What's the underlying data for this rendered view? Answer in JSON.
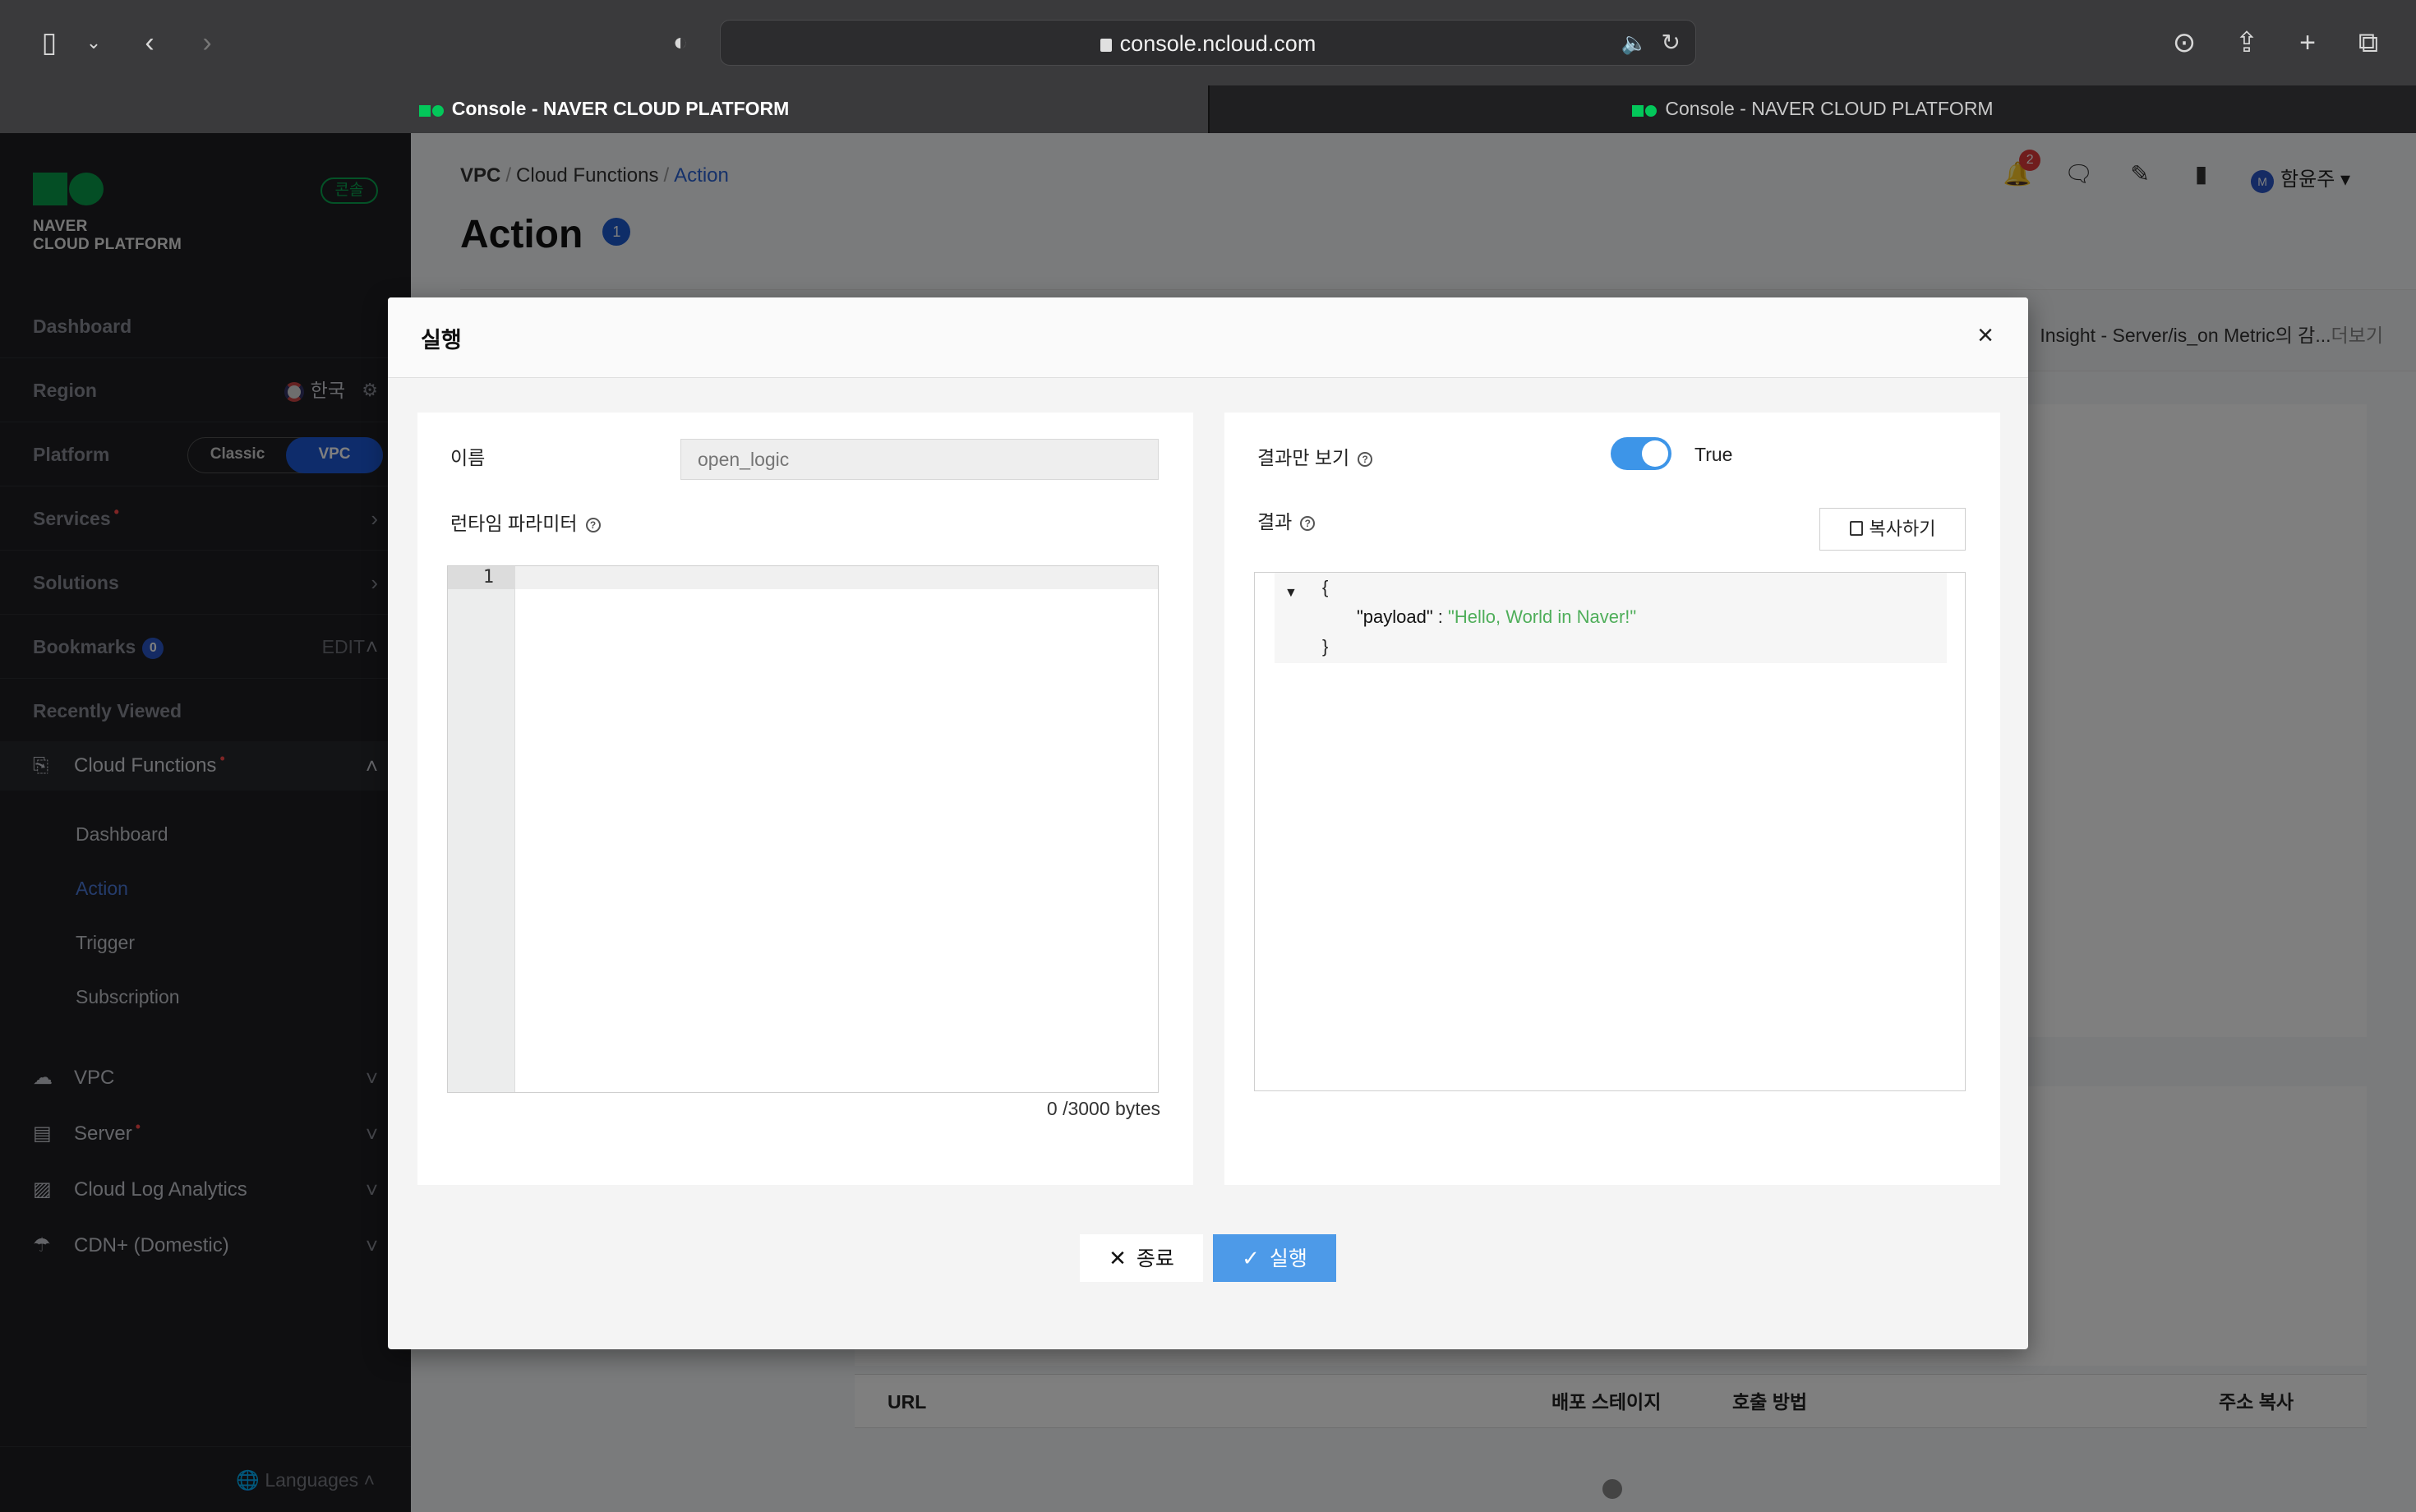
{
  "browser": {
    "url": "console.ncloud.com",
    "tabs": [
      {
        "label": "Console - NAVER CLOUD PLATFORM",
        "active": true
      },
      {
        "label": "Console - NAVER CLOUD PLATFORM",
        "active": false
      }
    ]
  },
  "sidebar": {
    "logo_line1": "NAVER",
    "logo_line2": "CLOUD PLATFORM",
    "console_badge": "콘솔",
    "dashboard": "Dashboard",
    "region_label": "Region",
    "region_value": "한국",
    "platform_label": "Platform",
    "platform_classic": "Classic",
    "platform_vpc": "VPC",
    "services": "Services",
    "solutions": "Solutions",
    "bookmarks": "Bookmarks",
    "bookmarks_count": "0",
    "bookmarks_edit": "EDIT",
    "recently_viewed": "Recently Viewed",
    "cloud_functions": "Cloud Functions",
    "sub_items": [
      "Dashboard",
      "Action",
      "Trigger",
      "Subscription"
    ],
    "services_list": [
      "VPC",
      "Server",
      "Cloud Log Analytics",
      "CDN+ (Domestic)"
    ],
    "languages": "Languages"
  },
  "main": {
    "breadcrumb": [
      "VPC",
      "Cloud Functions",
      "Action"
    ],
    "title": "Action",
    "title_badge": "1",
    "notification_count": "2",
    "user_initial": "M",
    "user_name": "함윤주",
    "notice_text": "Insight - Server/is_on Metric의 감...",
    "notice_more": "더보기",
    "table_headers": [
      "URL",
      "배포 스테이지",
      "호출 방법",
      "주소 복사"
    ]
  },
  "modal": {
    "title": "실행",
    "name_label": "이름",
    "name_placeholder": "open_logic",
    "runtime_param_label": "런타임 파라미터",
    "line_number": "1",
    "byte_count": "0 /3000 bytes",
    "result_only_label": "결과만 보기",
    "toggle_value": "True",
    "result_label": "결과",
    "copy_button": "복사하기",
    "json_open": "{",
    "json_key": "\"payload\"",
    "json_colon": " : ",
    "json_value": "\"Hello, World in Naver!\"",
    "json_close": "}",
    "close_button": "종료",
    "run_button": "실행"
  }
}
